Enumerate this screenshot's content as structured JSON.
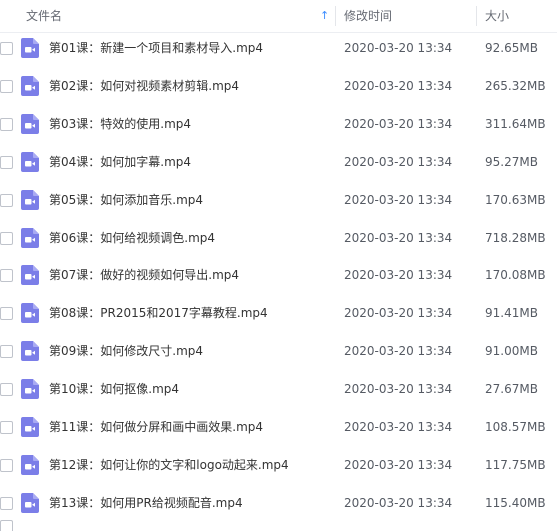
{
  "header": {
    "name_label": "文件名",
    "time_label": "修改时间",
    "size_label": "大小",
    "sort_indicator": "↑"
  },
  "colors": {
    "icon": "#7b7ee8",
    "sort_arrow": "#3b8cff",
    "text": "#333333"
  },
  "files": [
    {
      "name": "第01课：新建一个项目和素材导入.mp4",
      "time": "2020-03-20 13:34",
      "size": "92.65MB",
      "icon": "video-file-icon"
    },
    {
      "name": "第02课：如何对视频素材剪辑.mp4",
      "time": "2020-03-20 13:34",
      "size": "265.32MB",
      "icon": "video-file-icon"
    },
    {
      "name": "第03课：特效的使用.mp4",
      "time": "2020-03-20 13:34",
      "size": "311.64MB",
      "icon": "video-file-icon"
    },
    {
      "name": "第04课：如何加字幕.mp4",
      "time": "2020-03-20 13:34",
      "size": "95.27MB",
      "icon": "video-file-icon"
    },
    {
      "name": "第05课：如何添加音乐.mp4",
      "time": "2020-03-20 13:34",
      "size": "170.63MB",
      "icon": "video-file-icon"
    },
    {
      "name": "第06课：如何给视频调色.mp4",
      "time": "2020-03-20 13:34",
      "size": "718.28MB",
      "icon": "video-file-icon"
    },
    {
      "name": "第07课：做好的视频如何导出.mp4",
      "time": "2020-03-20 13:34",
      "size": "170.08MB",
      "icon": "video-file-icon"
    },
    {
      "name": "第08课：PR2015和2017字幕教程.mp4",
      "time": "2020-03-20 13:34",
      "size": "91.41MB",
      "icon": "video-file-icon"
    },
    {
      "name": "第09课：如何修改尺寸.mp4",
      "time": "2020-03-20 13:34",
      "size": "91.00MB",
      "icon": "video-file-icon"
    },
    {
      "name": "第10课：如何抠像.mp4",
      "time": "2020-03-20 13:34",
      "size": "27.67MB",
      "icon": "video-file-icon"
    },
    {
      "name": "第11课：如何做分屏和画中画效果.mp4",
      "time": "2020-03-20 13:34",
      "size": "108.57MB",
      "icon": "video-file-icon"
    },
    {
      "name": "第12课：如何让你的文字和logo动起来.mp4",
      "time": "2020-03-20 13:34",
      "size": "117.75MB",
      "icon": "video-file-icon"
    },
    {
      "name": "第13课：如何用PR给视频配音.mp4",
      "time": "2020-03-20 13:34",
      "size": "115.40MB",
      "icon": "video-file-icon"
    }
  ]
}
